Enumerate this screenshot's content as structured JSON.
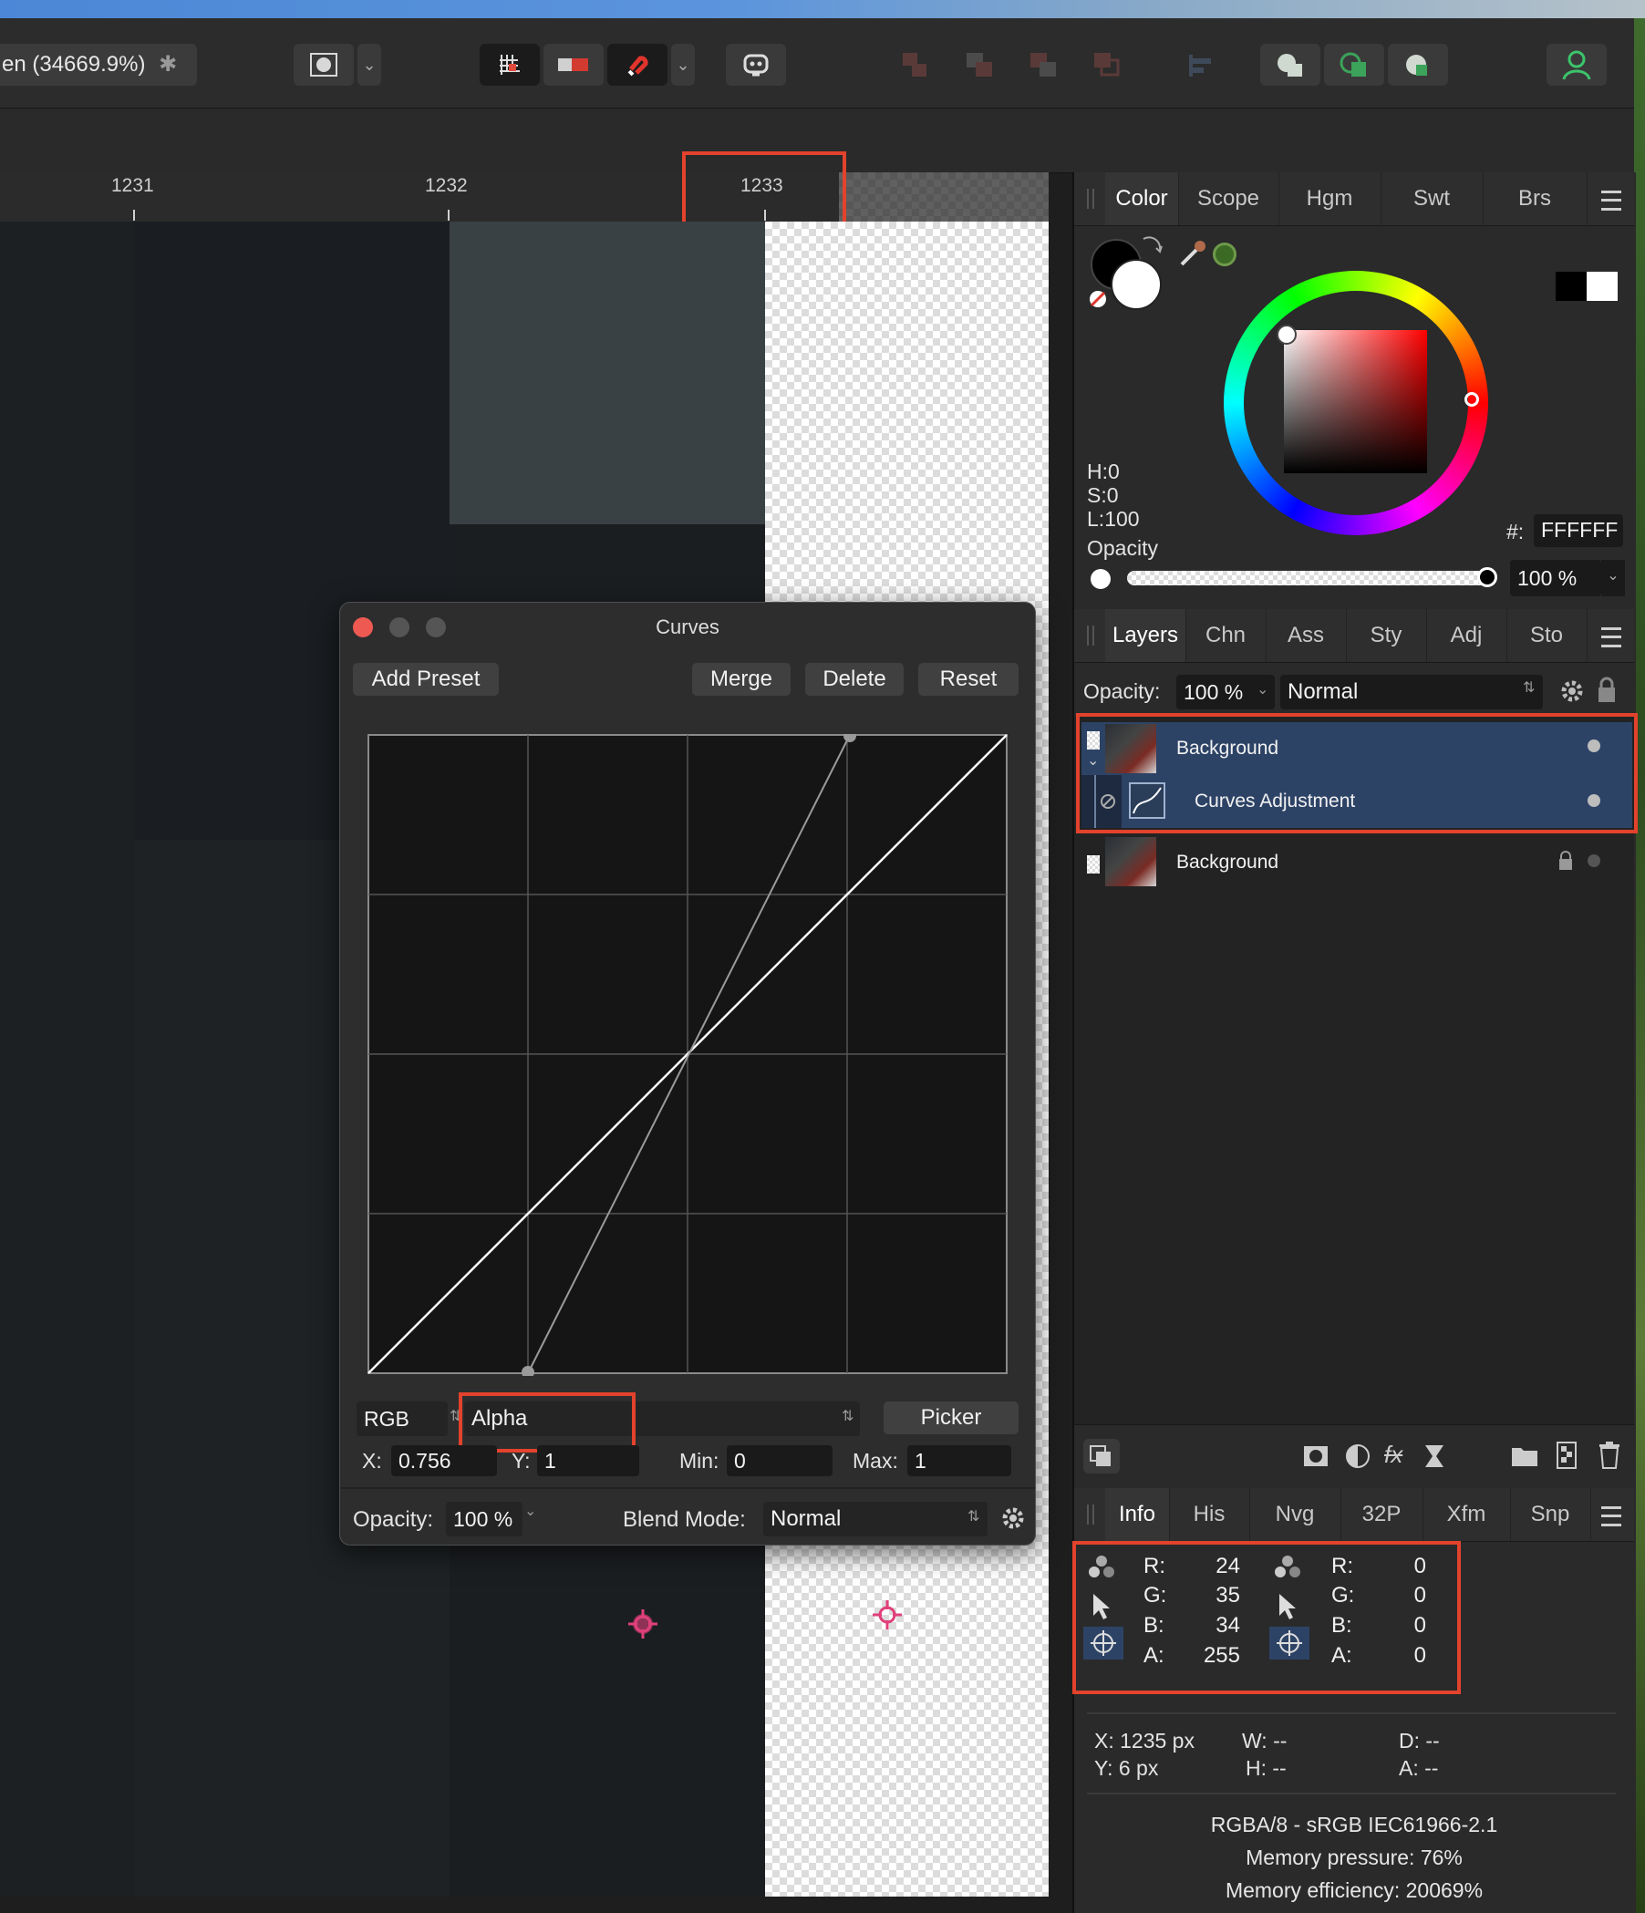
{
  "document": {
    "tab_title": "en (34669.9%)",
    "modified_mark": "✱"
  },
  "ruler": {
    "labels": [
      "1231",
      "1232",
      "1233"
    ]
  },
  "color_panel": {
    "tabs": [
      "Color",
      "Scope",
      "Hgm",
      "Swt",
      "Brs"
    ],
    "h_label": "H:",
    "h_value": "0",
    "s_label": "S:",
    "s_value": "0",
    "l_label": "L:",
    "l_value": "100",
    "hex_label": "#:",
    "hex_value": "FFFFFF",
    "opacity_label": "Opacity",
    "opacity_value": "100 %",
    "opacity_level": 1.0
  },
  "layers_panel": {
    "tabs": [
      "Layers",
      "Chn",
      "Ass",
      "Sty",
      "Adj",
      "Sto"
    ],
    "opacity_label": "Opacity:",
    "opacity_value": "100 %",
    "blend_mode": "Normal",
    "layers": [
      {
        "name": "Background"
      },
      {
        "name": "Curves Adjustment"
      },
      {
        "name": "Background"
      }
    ]
  },
  "info_panel": {
    "tabs": [
      "Info",
      "His",
      "Nvg",
      "32P",
      "Xfm",
      "Snp"
    ],
    "left": {
      "r_label": "R:",
      "r": "24",
      "g_label": "G:",
      "g": "35",
      "b_label": "B:",
      "b": "34",
      "a_label": "A:",
      "a": "255"
    },
    "right": {
      "r_label": "R:",
      "r": "0",
      "g_label": "G:",
      "g": "0",
      "b_label": "B:",
      "b": "0",
      "a_label": "A:",
      "a": "0"
    },
    "x": "X: 1235 px",
    "y": "Y: 6 px",
    "w": "W: --",
    "h": "H: --",
    "d": "D: --",
    "a": "A: --",
    "color_format": "RGBA/8 - sRGB IEC61966-2.1",
    "memory_pressure": "Memory pressure: 76%",
    "memory_efficiency": "Memory efficiency: 20069%"
  },
  "curves_dialog": {
    "title": "Curves",
    "add_preset": "Add Preset",
    "merge": "Merge",
    "delete": "Delete",
    "reset": "Reset",
    "channel_mode": "RGB",
    "channel": "Alpha",
    "picker": "Picker",
    "x_label": "X:",
    "x_value": "0.756",
    "y_label": "Y:",
    "y_value": "1",
    "min_label": "Min:",
    "min_value": "0",
    "max_label": "Max:",
    "max_value": "1",
    "opacity_label": "Opacity:",
    "opacity_value": "100 %",
    "blend_label": "Blend Mode:",
    "blend_value": "Normal"
  },
  "colors": {
    "accent_highlight": "#e3422c",
    "selected_layer": "#2d4366",
    "crosshair": "#e0407a"
  }
}
